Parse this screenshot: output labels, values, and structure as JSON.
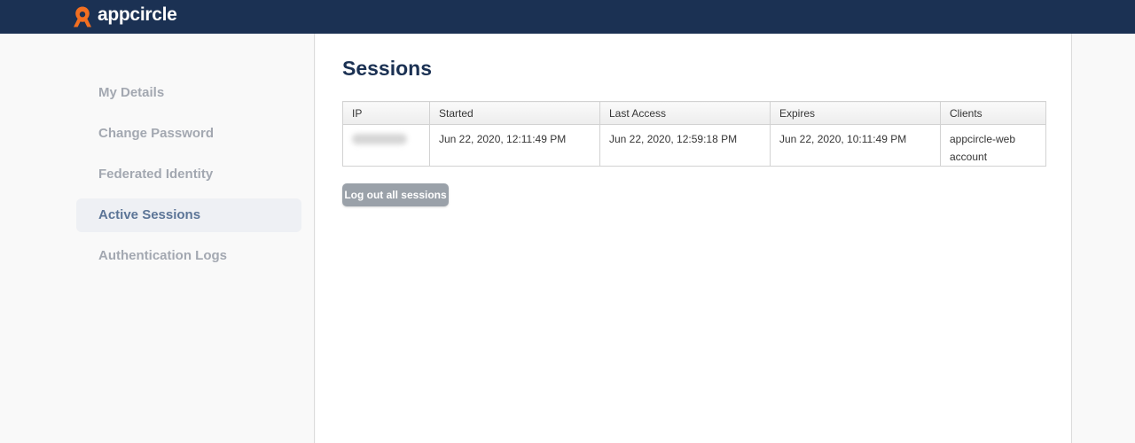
{
  "header": {
    "brand_name": "appcircle",
    "brand_color": "#1b3153",
    "logo_color": "#f26f21"
  },
  "sidebar": {
    "items": [
      {
        "label": "My Details",
        "active": false
      },
      {
        "label": "Change Password",
        "active": false
      },
      {
        "label": "Federated Identity",
        "active": false
      },
      {
        "label": "Active Sessions",
        "active": true
      },
      {
        "label": "Authentication Logs",
        "active": false
      }
    ]
  },
  "main": {
    "title": "Sessions",
    "table": {
      "columns": [
        "IP",
        "Started",
        "Last Access",
        "Expires",
        "Clients"
      ],
      "rows": [
        {
          "ip": "",
          "started": "Jun 22, 2020, 12:11:49 PM",
          "last_access": "Jun 22, 2020, 12:59:18 PM",
          "expires": "Jun 22, 2020, 10:11:49 PM",
          "clients": [
            "appcircle-web",
            "account"
          ]
        }
      ]
    },
    "logout_label": "Log out all sessions"
  }
}
